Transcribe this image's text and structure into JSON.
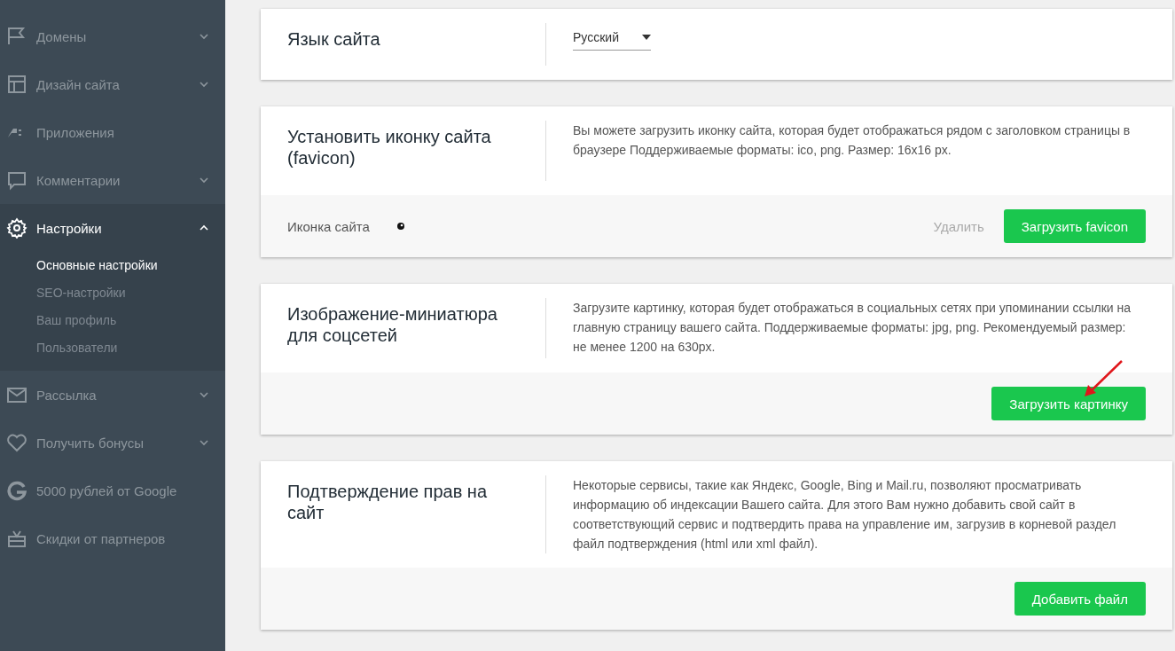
{
  "sidebar": {
    "items": [
      {
        "label": "Домены",
        "expanded": false
      },
      {
        "label": "Дизайн сайта",
        "expanded": false
      },
      {
        "label": "Приложения"
      },
      {
        "label": "Комментарии",
        "expanded": false
      },
      {
        "label": "Настройки",
        "expanded": true,
        "children": [
          {
            "label": "Основные настройки",
            "selected": true
          },
          {
            "label": "SEO-настройки",
            "selected": false
          },
          {
            "label": "Ваш профиль",
            "selected": false
          },
          {
            "label": "Пользователи",
            "selected": false
          }
        ]
      },
      {
        "label": "Рассылка",
        "expanded": false
      },
      {
        "label": "Получить бонусы",
        "expanded": false
      },
      {
        "label": "5000 рублей от Google"
      },
      {
        "label": "Скидки от партнеров"
      }
    ]
  },
  "cards": [
    {
      "title": "Язык сайта",
      "select": {
        "value": "Русский"
      }
    },
    {
      "title": "Установить иконку сайта (favicon)",
      "description": "Вы можете загрузить иконку сайта, которая будет отображаться рядом с заголовком страницы в браузере Поддерживаемые форматы: ico, png. Размер: 16x16 px.",
      "footer": {
        "label": "Иконка сайта",
        "buttons": [
          {
            "label": "Удалить",
            "kind": "link"
          },
          {
            "label": "Загрузить favicon",
            "kind": "primary"
          }
        ]
      }
    },
    {
      "title": "Изображение-миниатюра для соцсетей",
      "description": "Загрузите картинку, которая будет отображаться в социальных сетях при упоминании ссылки на главную страницу вашего сайта. Поддерживаемые форматы: jpg, png. Рекомендуемый размер: не менее 1200 на 630px.",
      "footer": {
        "buttons": [
          {
            "label": "Загрузить картинку",
            "kind": "primary"
          }
        ]
      }
    },
    {
      "title": "Подтверждение прав на сайт",
      "description": "Некоторые сервисы, такие как Яндекс, Google, Bing и Mail.ru, позволяют просматривать информацию об индексации Вашего сайта. Для этого Вам нужно добавить свой сайт в соответствующий сервис и подтвердить права на управление им, загрузив в корневой раздел файл подтверждения (html или xml файл).",
      "footer": {
        "buttons": [
          {
            "label": "Добавить файл",
            "kind": "primary"
          }
        ]
      }
    }
  ]
}
